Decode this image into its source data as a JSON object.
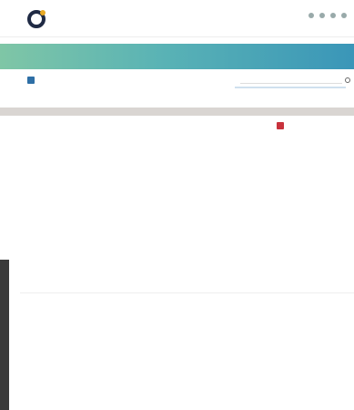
{
  "topbar": {
    "logo_text": "",
    "logo_suffix": "",
    "user": ""
  },
  "breadcrumb": "",
  "banner": {
    "title": "",
    "number": ""
  },
  "toolbar": {
    "primary": "",
    "links": [
      "",
      ""
    ],
    "search_label": "",
    "search_placeholder": ""
  },
  "record_actions": {
    "items": [
      "",
      "",
      "",
      "",
      "",
      "",
      "",
      ""
    ],
    "edit": "",
    "delete": "",
    "nav": [
      "",
      "",
      ""
    ]
  },
  "fields": {
    "name": {
      "label": "",
      "value": ""
    },
    "status": {
      "label": "",
      "value": ""
    },
    "type": {
      "label": "",
      "value": ""
    },
    "f3": {
      "label": "",
      "value": ""
    },
    "f4": {
      "label": "",
      "value": ""
    },
    "f5": {
      "label": "",
      "value": ""
    },
    "f6": {
      "label": "",
      "value": ""
    },
    "f7": {
      "label": "",
      "value": ""
    },
    "f8": {
      "label": "",
      "value": ""
    },
    "d1": {
      "label": "",
      "value": ""
    },
    "d2": {
      "label": "",
      "value": ""
    },
    "d3": {
      "label": "",
      "value": ""
    },
    "email": {
      "label": "",
      "value": ""
    },
    "d5": {
      "label": "",
      "value": ""
    },
    "d6": {
      "label": "",
      "value": ""
    },
    "e1": {
      "label": "",
      "value": ""
    },
    "e2": {
      "label": "",
      "value": ""
    },
    "e3": {
      "label": "",
      "value": ""
    }
  },
  "sections": [
    "",
    "",
    ""
  ]
}
